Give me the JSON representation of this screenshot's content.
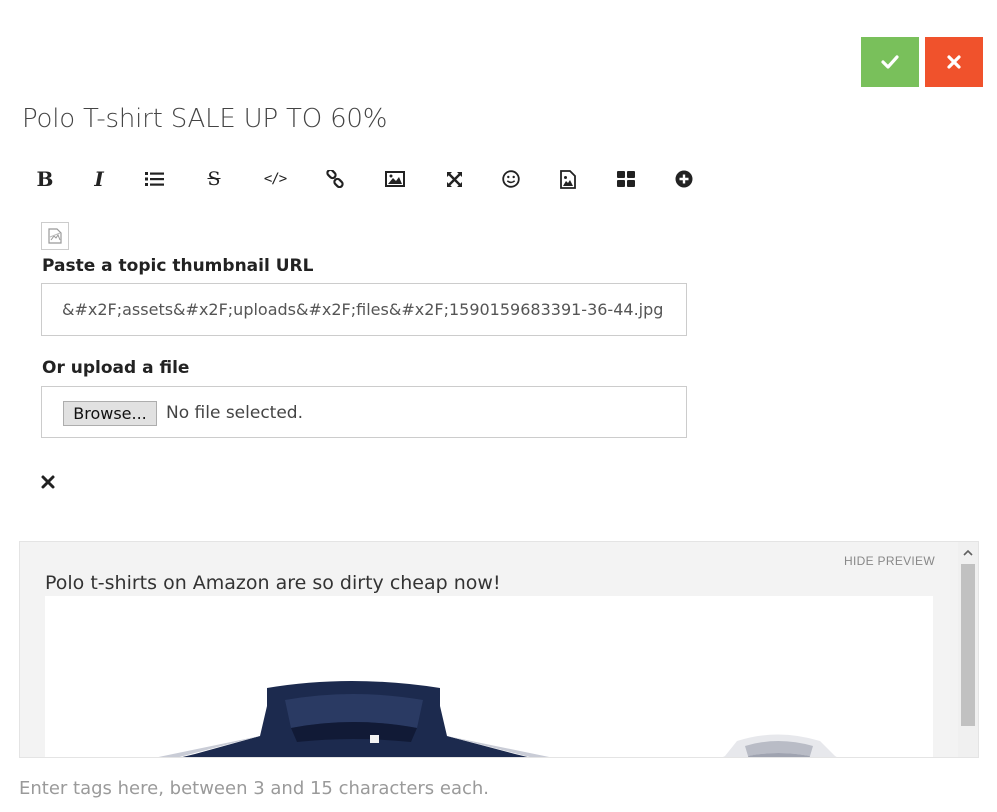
{
  "header": {
    "confirm_icon": "check-icon",
    "cancel_icon": "close-icon",
    "confirm_color": "#79c05b",
    "cancel_color": "#f0522c"
  },
  "title": "Polo T-shirt SALE UP TO 60%",
  "toolbar": {
    "items": [
      {
        "icon": "bold-icon",
        "glyph": "B"
      },
      {
        "icon": "italic-icon",
        "glyph": "I"
      },
      {
        "icon": "list-icon"
      },
      {
        "icon": "strikethrough-icon",
        "glyph": "S"
      },
      {
        "icon": "code-icon",
        "glyph": "</>"
      },
      {
        "icon": "link-icon"
      },
      {
        "icon": "image-icon"
      },
      {
        "icon": "fullscreen-icon"
      },
      {
        "icon": "emoji-icon"
      },
      {
        "icon": "upload-image-icon"
      },
      {
        "icon": "grid-icon"
      },
      {
        "icon": "plus-circle-icon"
      }
    ]
  },
  "thumbnail": {
    "url_label": "Paste a topic thumbnail URL",
    "url_value": "&#x2F;assets&#x2F;uploads&#x2F;files&#x2F;1590159683391-36-44.jpg",
    "upload_label": "Or upload a file",
    "browse_label": "Browse...",
    "no_file_text": "No file selected."
  },
  "preview": {
    "hide_label": "HIDE PREVIEW",
    "text": "Polo t-shirts on Amazon are so dirty cheap now!"
  },
  "tags": {
    "placeholder": "Enter tags here, between 3 and 15 characters each."
  }
}
